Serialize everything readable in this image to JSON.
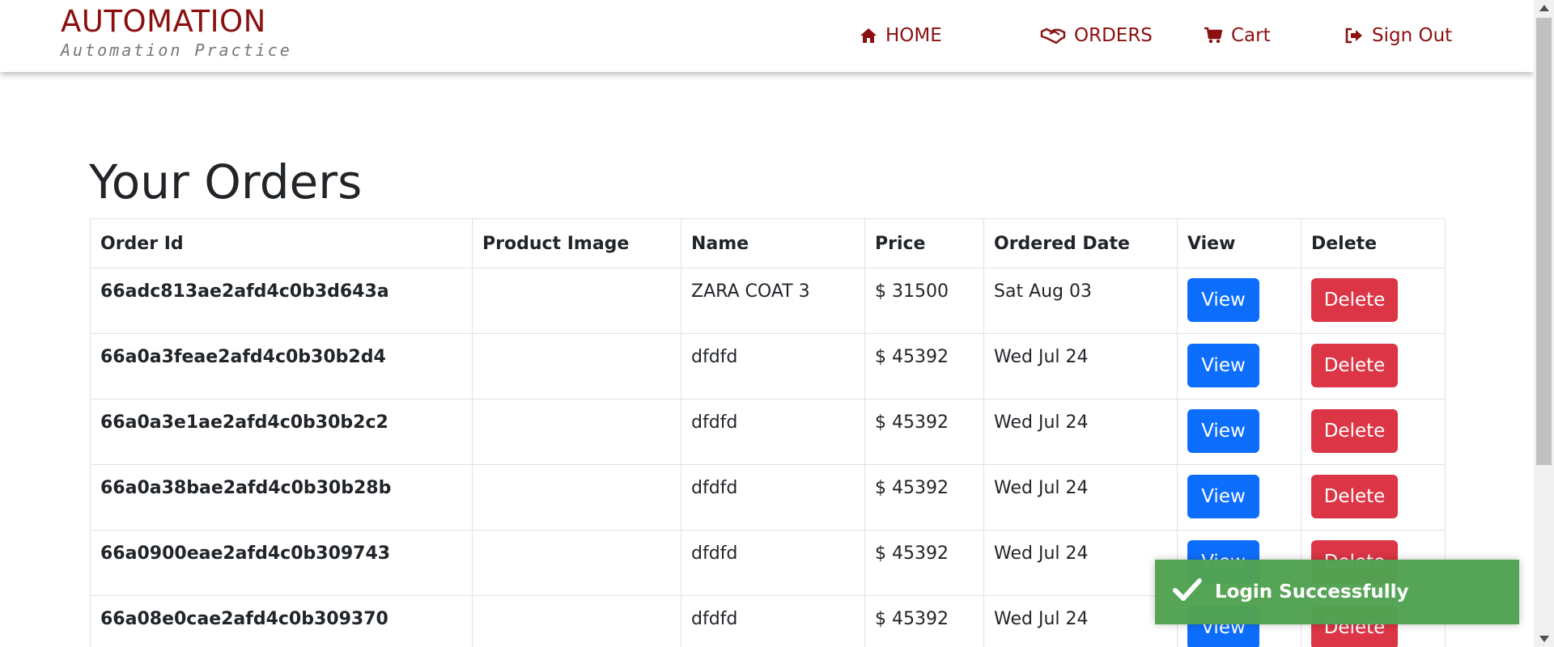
{
  "brand": {
    "title": "AUTOMATION",
    "subtitle": "Automation Practice"
  },
  "nav": {
    "home": {
      "label": "HOME",
      "icon": "home-icon"
    },
    "orders": {
      "label": "ORDERS",
      "icon": "handshake-icon"
    },
    "cart": {
      "label": "Cart",
      "icon": "cart-icon"
    },
    "signout": {
      "label": "Sign Out",
      "icon": "sign-out-icon"
    }
  },
  "page_title": "Your Orders",
  "table": {
    "headers": [
      "Order Id",
      "Product Image",
      "Name",
      "Price",
      "Ordered Date",
      "View",
      "Delete"
    ],
    "rows": [
      {
        "order_id": "66adc813ae2afd4c0b3d643a",
        "name": "ZARA COAT 3",
        "price": "$ 31500",
        "date": "Sat Aug 03",
        "view": "View",
        "delete": "Delete"
      },
      {
        "order_id": "66a0a3feae2afd4c0b30b2d4",
        "name": "dfdfd",
        "price": "$ 45392",
        "date": "Wed Jul 24",
        "view": "View",
        "delete": "Delete"
      },
      {
        "order_id": "66a0a3e1ae2afd4c0b30b2c2",
        "name": "dfdfd",
        "price": "$ 45392",
        "date": "Wed Jul 24",
        "view": "View",
        "delete": "Delete"
      },
      {
        "order_id": "66a0a38bae2afd4c0b30b28b",
        "name": "dfdfd",
        "price": "$ 45392",
        "date": "Wed Jul 24",
        "view": "View",
        "delete": "Delete"
      },
      {
        "order_id": "66a0900eae2afd4c0b309743",
        "name": "dfdfd",
        "price": "$ 45392",
        "date": "Wed Jul 24",
        "view": "View",
        "delete": "Delete"
      },
      {
        "order_id": "66a08e0cae2afd4c0b309370",
        "name": "dfdfd",
        "price": "$ 45392",
        "date": "Wed Jul 24",
        "view": "View",
        "delete": "Delete"
      }
    ]
  },
  "toast": {
    "message": "Login Successfully",
    "icon": "checkmark-icon"
  },
  "colors": {
    "brand": "#8b1010",
    "view_button": "#0d6efd",
    "delete_button": "#dc3545",
    "toast_success": "#51a351"
  }
}
